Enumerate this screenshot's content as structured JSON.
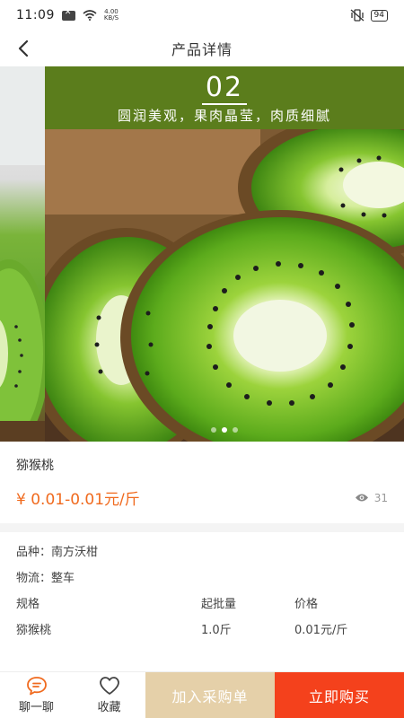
{
  "status_bar": {
    "time": "11:09",
    "speed_value": "4.00",
    "speed_unit": "KB/S",
    "battery": "94"
  },
  "nav": {
    "title": "产品详情"
  },
  "carousel": {
    "slide_number": "02",
    "caption": "圆润美观，果肉晶莹，肉质细腻",
    "dots": 3,
    "active_dot": 1
  },
  "product": {
    "name": "猕猴桃",
    "price": "¥ 0.01-0.01元/斤",
    "views": "31"
  },
  "details": {
    "variety_label": "品种：",
    "variety_value": "南方沃柑",
    "logistics_label": "物流：",
    "logistics_value": "整车",
    "table": {
      "headers": [
        "规格",
        "起批量",
        "价格"
      ],
      "rows": [
        [
          "猕猴桃",
          "1.0斤",
          "0.01元/斤"
        ]
      ]
    }
  },
  "bottom_bar": {
    "chat_label": "聊一聊",
    "favorite_label": "收藏",
    "cart_label": "加入采购单",
    "buy_label": "立即购买"
  },
  "colors": {
    "price": "#f06a1e",
    "cart": "#e5d0a9",
    "buy": "#f4411c",
    "header_green": "#5b7d1c"
  }
}
